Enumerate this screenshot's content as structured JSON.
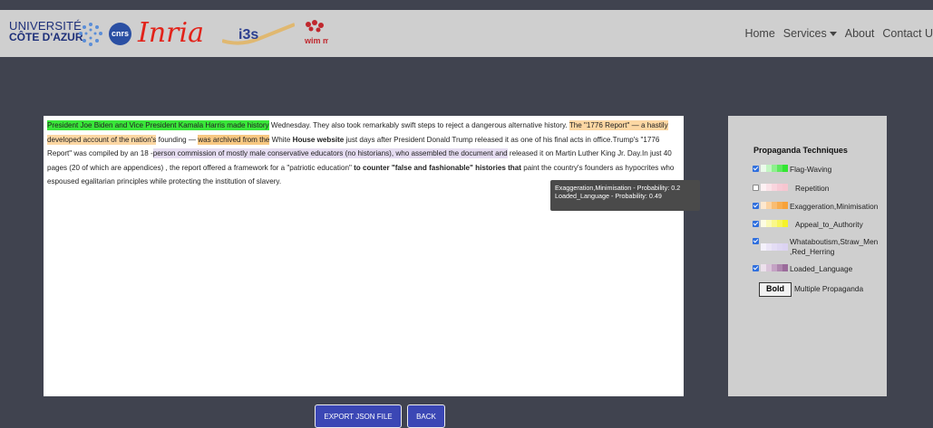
{
  "navbar": {
    "logos": {
      "uca_line1": "UNIVERSITÉ",
      "uca_line2": "CÔTE D'AZUR",
      "cnrs": "cnrs",
      "inria": "Inria",
      "i3s": "i3s",
      "wimmics": "wim mics"
    },
    "links": {
      "home": "Home",
      "services": "Services",
      "about": "About",
      "contact": "Contact U"
    }
  },
  "article": {
    "s1": "President Joe Biden and Vice President Kamala Harris made history",
    "s2": " Wednesday. They also took remarkably swift steps to reject a dangerous alternative history. ",
    "s3": "The \"1776 Report\" — a hastily developed account of the nation's",
    "s4": " founding — ",
    "s5": "was archived from the",
    "s6": " White ",
    "s7": "House website",
    "s8": " just days after President Donald Trump released it as one of his final acts in office.Trump's \"1776 Report\" was compiled by an 18 -",
    "s9": "person commission of mostly male conservative educators (no historians), who assembled the document and",
    "s10": " released it on Martin Luther King Jr. Day.In just 40 pages (20 of which are appendices) , the report offered a framework for a \"patriotic education\" ",
    "s11": "to counter \"false and fashionable\" histories that",
    "s12": " paint the country's founders as hypocrites who espoused egalitarian principles while protecting the institution of slavery."
  },
  "tooltip": {
    "line1": "Exaggeration,Minimisation - Probability: 0.2",
    "line2": "Loaded_Language - Probability: 0.49"
  },
  "legend": {
    "title": "Propaganda Techniques",
    "items": [
      {
        "label": "Flag-Waving",
        "checked": true
      },
      {
        "label": "Repetition",
        "checked": false
      },
      {
        "label": "Exaggeration,Minimisation",
        "checked": true
      },
      {
        "label": "Appeal_to_Authority",
        "checked": true
      },
      {
        "label": "Whataboutism,Straw_Men ,Red_Herring",
        "checked": true
      },
      {
        "label": "Loaded_Language",
        "checked": true
      }
    ],
    "bold_box": "Bold",
    "multi_label": "Multiple Propaganda"
  },
  "buttons": {
    "export": "EXPORT JSON FILE",
    "back": "BACK"
  },
  "colors": {
    "flag_waving": "#33e633",
    "repetition": "#f6c6d0",
    "exaggeration": "#f7a23a",
    "appeal_authority": "#f5f22a",
    "whataboutism": "#dcd3f2",
    "loaded_language": "#9b6b9b"
  }
}
